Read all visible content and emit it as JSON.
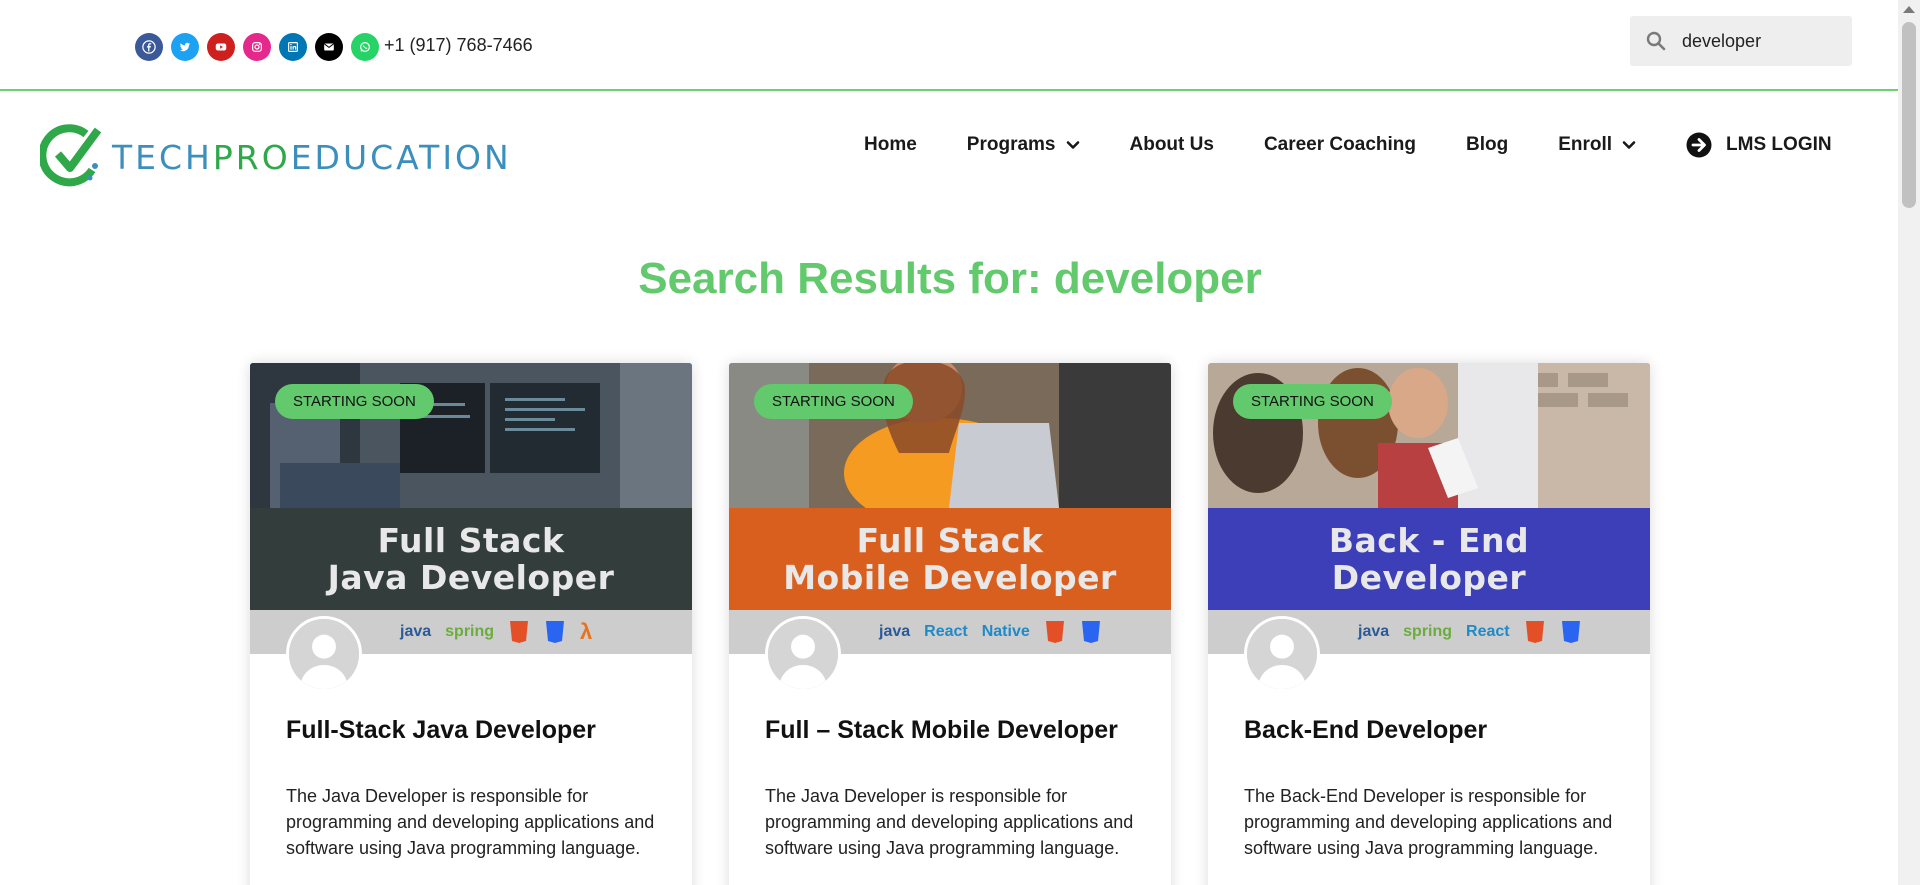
{
  "topbar": {
    "socials": [
      {
        "icon": "facebook-icon",
        "color": "#3b5998",
        "glyph": "f"
      },
      {
        "icon": "twitter-icon",
        "color": "#1da1f2",
        "glyph": "t"
      },
      {
        "icon": "youtube-icon",
        "color": "#cd201f",
        "glyph": "y"
      },
      {
        "icon": "instagram-icon",
        "color": "#e4288c",
        "glyph": "i"
      },
      {
        "icon": "linkedin-icon",
        "color": "#0077b5",
        "glyph": "in"
      },
      {
        "icon": "envelope-icon",
        "color": "#000000",
        "glyph": "m"
      },
      {
        "icon": "whatsapp-icon",
        "color": "#25d366",
        "glyph": "w"
      }
    ],
    "phone": "+1 (917) 768-7466"
  },
  "search": {
    "value": "developer"
  },
  "logo": {
    "part1": "TECH",
    "part2": "PRO",
    "part3": "EDUCATION"
  },
  "nav": {
    "home": "Home",
    "programs": "Programs",
    "about": "About Us",
    "career": "Career Coaching",
    "blog": "Blog",
    "enroll": "Enroll",
    "lms": "LMS LOGIN"
  },
  "page": {
    "heading": "Search Results for: developer"
  },
  "cards": [
    {
      "badge": "STARTING SOON",
      "banner_line1": "Full Stack",
      "banner_line2": "Java Developer",
      "banner_color": "#333d3b",
      "techs": [
        "java",
        "spring"
      ],
      "title": "Full-Stack Java Developer",
      "desc": "The Java Developer is responsible for programming and developing applications and software using Java programming language."
    },
    {
      "badge": "STARTING SOON",
      "banner_line1": "Full Stack",
      "banner_line2": "Mobile Developer",
      "banner_color": "#d95f1f",
      "techs": [
        "java",
        "React",
        "Native"
      ],
      "title": "Full – Stack Mobile Developer",
      "desc": "The Java Developer is responsible for programming and developing applications and software using Java programming language."
    },
    {
      "badge": "STARTING SOON",
      "banner_line1": "Back - End",
      "banner_line2": "Developer",
      "banner_color": "#3c3fb8",
      "techs": [
        "java",
        "spring",
        "React"
      ],
      "title": "Back-End Developer",
      "desc": "The Back-End Developer is responsible for programming and developing applications and software using Java programming language."
    }
  ],
  "colors": {
    "accent_green": "#62c96c"
  }
}
